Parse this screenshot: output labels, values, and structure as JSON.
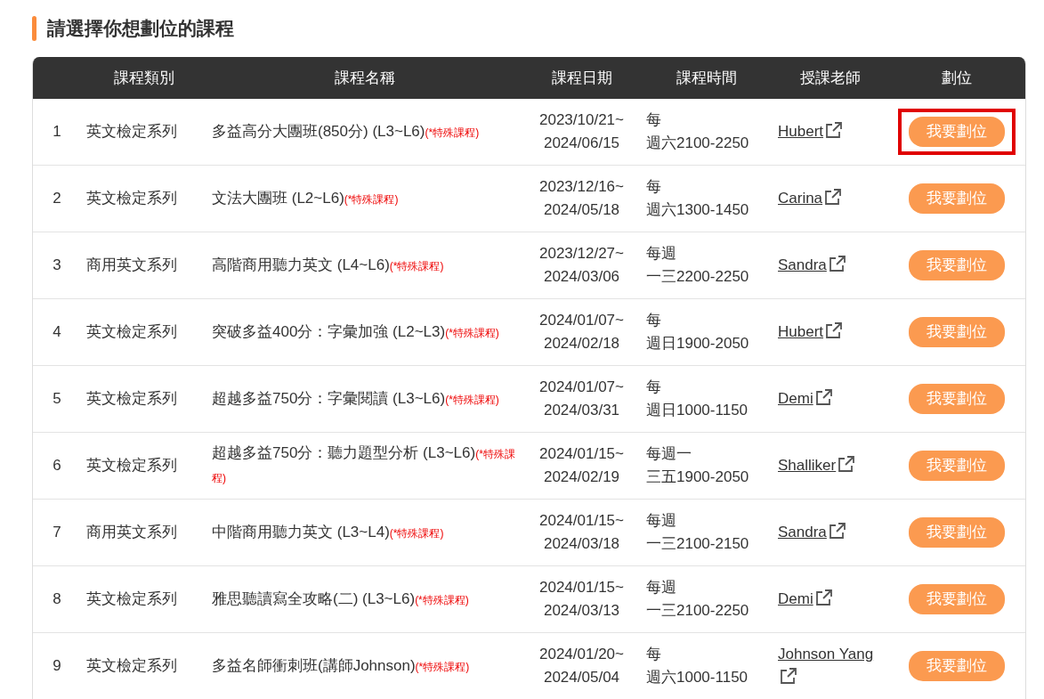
{
  "title": "請選擇你想劃位的課程",
  "table": {
    "columns": [
      "課程類別",
      "課程名稱",
      "課程日期",
      "課程時間",
      "授課老師",
      "劃位"
    ],
    "rows": [
      {
        "index": "1",
        "category": "英文檢定系列",
        "name": "多益高分大團班(850分) (L3~L6)",
        "note": "(*特殊課程)",
        "date": [
          "2023/10/21~",
          "2024/06/15"
        ],
        "time": [
          "每",
          "週六2100-2250"
        ],
        "teacher": "Hubert",
        "button": "我要劃位",
        "highlighted": true
      },
      {
        "index": "2",
        "category": "英文檢定系列",
        "name": "文法大團班 (L2~L6)",
        "note": "(*特殊課程)",
        "date": [
          "2023/12/16~",
          "2024/05/18"
        ],
        "time": [
          "每",
          "週六1300-1450"
        ],
        "teacher": "Carina",
        "button": "我要劃位",
        "highlighted": false
      },
      {
        "index": "3",
        "category": "商用英文系列",
        "name": "高階商用聽力英文 (L4~L6)",
        "note": "(*特殊課程)",
        "date": [
          "2023/12/27~",
          "2024/03/06"
        ],
        "time": [
          "每週",
          "一三2200-2250"
        ],
        "teacher": "Sandra",
        "button": "我要劃位",
        "highlighted": false
      },
      {
        "index": "4",
        "category": "英文檢定系列",
        "name": "突破多益400分：字彙加強 (L2~L3)",
        "note": "(*特殊課程)",
        "date": [
          "2024/01/07~",
          "2024/02/18"
        ],
        "time": [
          "每",
          "週日1900-2050"
        ],
        "teacher": "Hubert",
        "button": "我要劃位",
        "highlighted": false
      },
      {
        "index": "5",
        "category": "英文檢定系列",
        "name": "超越多益750分：字彙閱讀 (L3~L6)",
        "note": "(*特殊課程)",
        "date": [
          "2024/01/07~",
          "2024/03/31"
        ],
        "time": [
          "每",
          "週日1000-1150"
        ],
        "teacher": "Demi",
        "button": "我要劃位",
        "highlighted": false
      },
      {
        "index": "6",
        "category": "英文檢定系列",
        "name": "超越多益750分：聽力題型分析 (L3~L6)",
        "note": "(*特殊課程)",
        "date": [
          "2024/01/15~",
          "2024/02/19"
        ],
        "time": [
          "每週一",
          "三五1900-2050"
        ],
        "teacher": "Shalliker",
        "button": "我要劃位",
        "highlighted": false
      },
      {
        "index": "7",
        "category": "商用英文系列",
        "name": "中階商用聽力英文 (L3~L4)",
        "note": "(*特殊課程)",
        "date": [
          "2024/01/15~",
          "2024/03/18"
        ],
        "time": [
          "每週",
          "一三2100-2150"
        ],
        "teacher": "Sandra",
        "button": "我要劃位",
        "highlighted": false
      },
      {
        "index": "8",
        "category": "英文檢定系列",
        "name": "雅思聽讀寫全攻略(二) (L3~L6)",
        "note": "(*特殊課程)",
        "date": [
          "2024/01/15~",
          "2024/03/13"
        ],
        "time": [
          "每週",
          "一三2100-2250"
        ],
        "teacher": "Demi",
        "button": "我要劃位",
        "highlighted": false
      },
      {
        "index": "9",
        "category": "英文檢定系列",
        "name": "多益名師衝刺班(講師Johnson)",
        "note": "(*特殊課程)",
        "date": [
          "2024/01/20~",
          "2024/05/04"
        ],
        "time": [
          "每",
          "週六1000-1150"
        ],
        "teacher": "Johnson Yang",
        "button": "我要劃位",
        "highlighted": false
      }
    ]
  }
}
